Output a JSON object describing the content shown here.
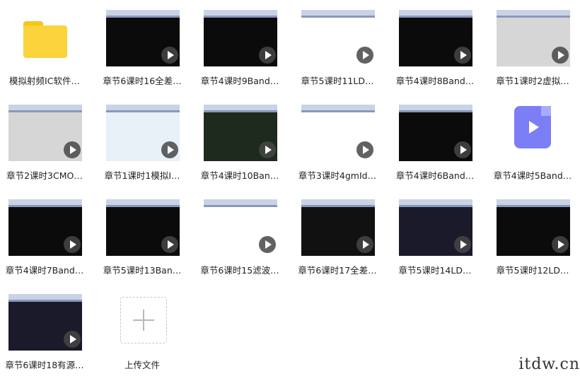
{
  "items": [
    {
      "label": "模拟射频IC软件…",
      "kind": "folder"
    },
    {
      "label": "章节6课时16全差…",
      "kind": "video",
      "style": "b-dark"
    },
    {
      "label": "章节4课时9Band…",
      "kind": "video",
      "style": "b-dark"
    },
    {
      "label": "章节5课时11LD…",
      "kind": "video",
      "style": "b-doc"
    },
    {
      "label": "章节4课时8Band…",
      "kind": "video",
      "style": "b-dark"
    },
    {
      "label": "章节1课时2虚拟…",
      "kind": "video",
      "style": "b-grey"
    },
    {
      "label": "章节2课时3CMO…",
      "kind": "video",
      "style": "b-grey"
    },
    {
      "label": "章节1课时1模拟I…",
      "kind": "video",
      "style": "b-table"
    },
    {
      "label": "章节4课时10Ban…",
      "kind": "video",
      "style": "b-green"
    },
    {
      "label": "章节3课时4gmId…",
      "kind": "video",
      "style": "b-doc"
    },
    {
      "label": "章节4课时6Band…",
      "kind": "video",
      "style": "b-dark"
    },
    {
      "label": "章节4课时5Band…",
      "kind": "videofile"
    },
    {
      "label": "章节4课时7Band…",
      "kind": "video",
      "style": "b-dark"
    },
    {
      "label": "章节5课时13Ban…",
      "kind": "video",
      "style": "b-dark"
    },
    {
      "label": "章节6课时15滤波…",
      "kind": "video",
      "style": "b-doc"
    },
    {
      "label": "章节6课时17全差…",
      "kind": "video",
      "style": "b-layout"
    },
    {
      "label": "章节5课时14LD…",
      "kind": "video",
      "style": "b-blue"
    },
    {
      "label": "章节5课时12LD…",
      "kind": "video",
      "style": "b-dark"
    },
    {
      "label": "章节6课时18有源…",
      "kind": "video",
      "style": "b-blue"
    },
    {
      "label": "上传文件",
      "kind": "upload"
    }
  ],
  "watermark": "itdw.cn"
}
